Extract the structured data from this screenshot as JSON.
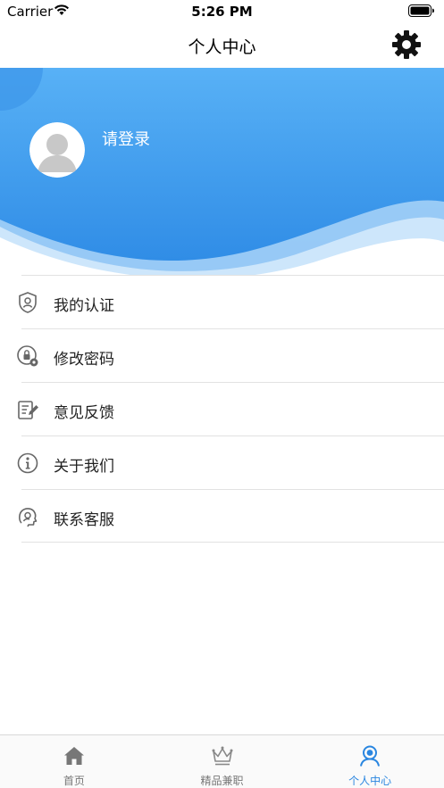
{
  "status_bar": {
    "carrier": "Carrier",
    "time": "5:26 PM"
  },
  "nav": {
    "title": "个人中心",
    "settings_icon": "gear-icon"
  },
  "header": {
    "login_prompt": "请登录",
    "avatar_icon": "default-avatar-icon",
    "colors": {
      "banner_top": "#55aff5",
      "banner_bottom": "#2f8ce6"
    }
  },
  "menu": {
    "items": [
      {
        "label": "我的认证",
        "icon": "shield-user-icon"
      },
      {
        "label": "修改密码",
        "icon": "lock-gear-icon"
      },
      {
        "label": "意见反馈",
        "icon": "feedback-edit-icon"
      },
      {
        "label": "关于我们",
        "icon": "info-icon"
      },
      {
        "label": "联系客服",
        "icon": "customer-service-icon"
      }
    ]
  },
  "tab_bar": {
    "tabs": [
      {
        "label": "首页",
        "icon": "home-icon",
        "active": false
      },
      {
        "label": "精品兼职",
        "icon": "crown-icon",
        "active": false
      },
      {
        "label": "个人中心",
        "icon": "user-center-icon",
        "active": true
      }
    ],
    "active_color": "#2a86e0"
  }
}
